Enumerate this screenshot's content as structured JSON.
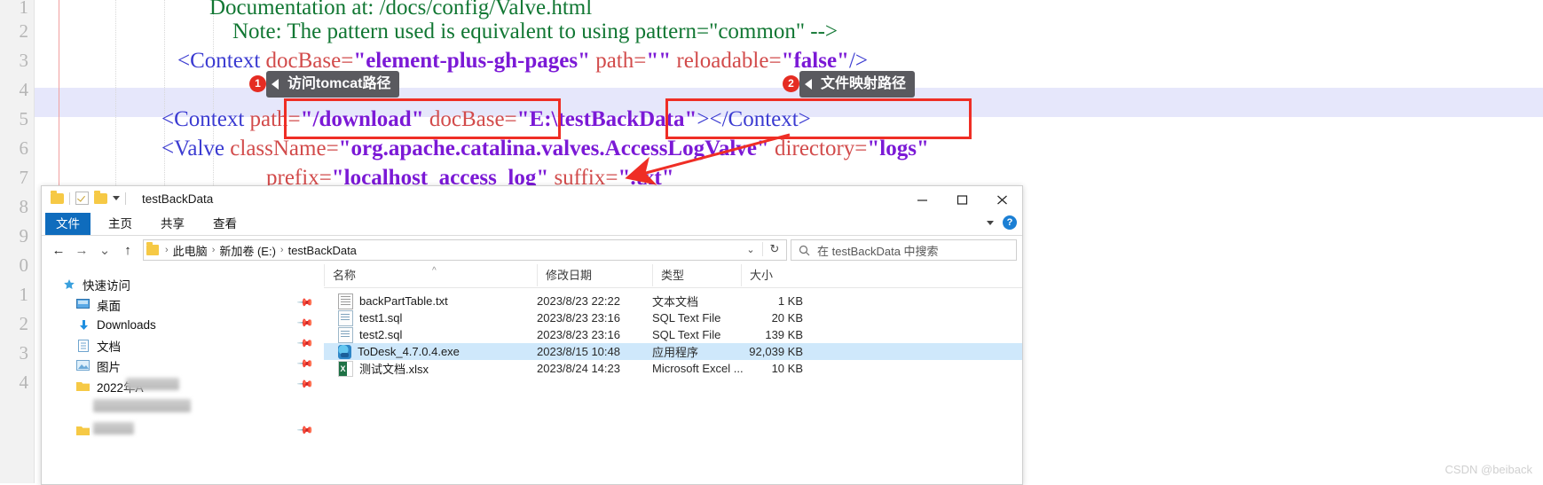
{
  "editor": {
    "line_numbers": [
      "1",
      "2",
      "3",
      "4",
      "5",
      "6",
      "7",
      "8",
      "9",
      "0",
      "1",
      "2",
      "3",
      "4"
    ],
    "lines": [
      {
        "n": "1",
        "indent": 236,
        "segments": [
          {
            "t": "Documentation at: /docs/config/Valve.html",
            "c": "comment"
          }
        ]
      },
      {
        "n": "2",
        "indent": 262,
        "segments": [
          {
            "t": "Note: The pattern used is equivalent to using pattern=\"common\" -->",
            "c": "comment"
          }
        ]
      },
      {
        "n": "3",
        "indent": 200,
        "segments": [
          {
            "t": "<Context ",
            "c": "tag"
          },
          {
            "t": "docBase=",
            "c": "attr"
          },
          {
            "t": "\"element-plus-gh-pages\"",
            "c": "val"
          },
          {
            "t": " path=",
            "c": "attr"
          },
          {
            "t": "\"\"",
            "c": "val"
          },
          {
            "t": " reloadable=",
            "c": "attr"
          },
          {
            "t": "\"false\"",
            "c": "val"
          },
          {
            "t": "/>",
            "c": "tag"
          }
        ]
      },
      {
        "n": "4",
        "indent": 0,
        "segments": []
      },
      {
        "n": "5",
        "indent": 182,
        "segments": [
          {
            "t": "<Context ",
            "c": "tag"
          },
          {
            "t": "path=",
            "c": "attr"
          },
          {
            "t": "\"/download\"",
            "c": "val"
          },
          {
            "t": " docBase=",
            "c": "attr"
          },
          {
            "t": "\"E:\\testBackData\"",
            "c": "val"
          },
          {
            "t": "></Context>",
            "c": "tag"
          }
        ]
      },
      {
        "n": "6",
        "indent": 182,
        "segments": [
          {
            "t": "<Valve ",
            "c": "tag"
          },
          {
            "t": "className=",
            "c": "attr"
          },
          {
            "t": "\"org.apache.catalina.valves.AccessLogValve\"",
            "c": "val"
          },
          {
            "t": " directory=",
            "c": "attr"
          },
          {
            "t": "\"logs\"",
            "c": "val"
          }
        ]
      },
      {
        "n": "7",
        "indent": 300,
        "segments": [
          {
            "t": "prefix=",
            "c": "attr"
          },
          {
            "t": "\"localhost_access_log\"",
            "c": "val"
          },
          {
            "t": " suffix=",
            "c": "attr"
          },
          {
            "t": "\".txt\"",
            "c": "val"
          }
        ]
      }
    ],
    "highlighted_line": "4"
  },
  "annotations": {
    "callout1": {
      "badge": "1",
      "text": "访问tomcat路径"
    },
    "callout2": {
      "badge": "2",
      "text": "文件映射路径"
    },
    "accent_color": "#ef2e25"
  },
  "explorer": {
    "title": "testBackData",
    "window_buttons": {
      "minimize": "minimize-icon",
      "maximize": "maximize-icon",
      "close": "close-icon"
    },
    "ribbon_tabs": [
      {
        "label": "文件",
        "active": true
      },
      {
        "label": "主页",
        "active": false
      },
      {
        "label": "共享",
        "active": false
      },
      {
        "label": "查看",
        "active": false
      }
    ],
    "help_badge": "?",
    "nav_buttons": {
      "back": "←",
      "forward": "→",
      "recent": "⌄",
      "up": "↑"
    },
    "address": {
      "crumbs": [
        "此电脑",
        "新加卷 (E:)",
        "testBackData"
      ],
      "dropdown": "⌄",
      "refresh": "↻"
    },
    "search": {
      "icon": "search-icon",
      "placeholder": "在 testBackData 中搜索"
    },
    "nav_pane": [
      {
        "label": "快速访问",
        "icon": "star-icon",
        "pinned": false
      },
      {
        "label": "桌面",
        "icon": "desktop-icon",
        "pinned": true
      },
      {
        "label": "Downloads",
        "icon": "download-icon",
        "pinned": true
      },
      {
        "label": "文档",
        "icon": "documents-icon",
        "pinned": true
      },
      {
        "label": "图片",
        "icon": "pictures-icon",
        "pinned": true
      },
      {
        "label": "2022年A",
        "icon": "folder-icon",
        "pinned": false,
        "blurred": true
      },
      {
        "label": "",
        "icon": "",
        "pinned": false,
        "blurred": true
      },
      {
        "label": "",
        "icon": "folder-icon",
        "pinned": false,
        "blurred": true
      }
    ],
    "columns": [
      {
        "label": "名称",
        "sorted": true
      },
      {
        "label": "修改日期",
        "sorted": false
      },
      {
        "label": "类型",
        "sorted": false
      },
      {
        "label": "大小",
        "sorted": false
      }
    ],
    "files": [
      {
        "name": "backPartTable.txt",
        "date": "2023/8/23 22:22",
        "type": "文本文档",
        "size": "1 KB",
        "icon": "text-file-icon",
        "selected": false
      },
      {
        "name": "test1.sql",
        "date": "2023/8/23 23:16",
        "type": "SQL Text File",
        "size": "20 KB",
        "icon": "sql-file-icon",
        "selected": false
      },
      {
        "name": "test2.sql",
        "date": "2023/8/23 23:16",
        "type": "SQL Text File",
        "size": "139 KB",
        "icon": "sql-file-icon",
        "selected": false
      },
      {
        "name": "ToDesk_4.7.0.4.exe",
        "date": "2023/8/15 10:48",
        "type": "应用程序",
        "size": "92,039 KB",
        "icon": "exe-file-icon",
        "selected": true
      },
      {
        "name": "测试文档.xlsx",
        "date": "2023/8/24 14:23",
        "type": "Microsoft Excel ...",
        "size": "10 KB",
        "icon": "excel-file-icon",
        "selected": false
      }
    ]
  },
  "watermark": "CSDN @beiback"
}
